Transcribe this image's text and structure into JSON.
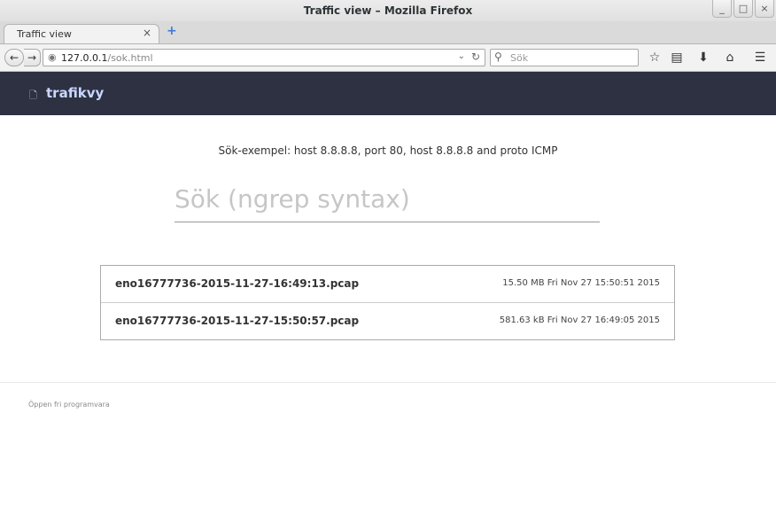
{
  "window": {
    "title": "Traffic view – Mozilla Firefox",
    "min": "_",
    "max": "□",
    "close": "×"
  },
  "tab": {
    "label": "Traffic view",
    "close": "×",
    "new": "+"
  },
  "nav": {
    "back": "←",
    "forward": "→",
    "url_host": "127.0.0.1",
    "url_path": "/sok.html",
    "search_placeholder": "Sök"
  },
  "site": {
    "brand": "trafikvy"
  },
  "main": {
    "hint": "Sök-exempel: host 8.8.8.8, port 80, host 8.8.8.8 and proto ICMP",
    "search_placeholder": "Sök (ngrep syntax)",
    "results": [
      {
        "name": "eno16777736-2015-11-27-16:49:13.pcap",
        "meta": "15.50 MB Fri Nov 27 15:50:51 2015"
      },
      {
        "name": "eno16777736-2015-11-27-15:50:57.pcap",
        "meta": "581.63 kB Fri Nov 27 16:49:05 2015"
      }
    ]
  },
  "footer": {
    "text": "Öppen fri programvara"
  }
}
